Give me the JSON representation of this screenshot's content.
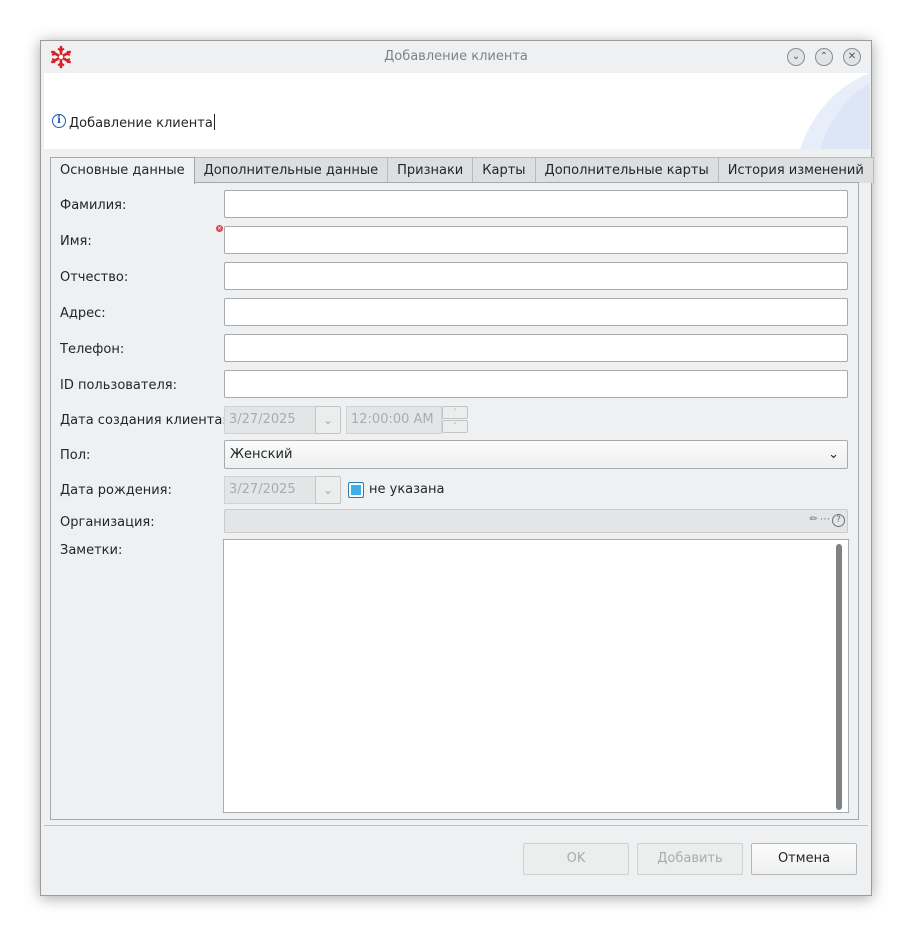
{
  "window": {
    "title": "Добавление клиента",
    "header_message": "Добавление клиента"
  },
  "tabs": [
    {
      "label": "Основные данные",
      "active": true
    },
    {
      "label": "Дополнительные данные"
    },
    {
      "label": "Признаки"
    },
    {
      "label": "Карты"
    },
    {
      "label": "Дополнительные карты"
    },
    {
      "label": "История изменений"
    }
  ],
  "form": {
    "last_name_label": "Фамилия:",
    "first_name_label": "Имя:",
    "middle_name_label": "Отчество:",
    "address_label": "Адрес:",
    "phone_label": "Телефон:",
    "user_id_label": "ID пользователя:",
    "created_label": "Дата создания клиента:",
    "created_date": "3/27/2025",
    "created_time": "12:00:00 AM",
    "gender_label": "Пол:",
    "gender_value": "Женский",
    "birth_label": "Дата рождения:",
    "birth_date": "3/27/2025",
    "birth_unspecified_label": "не указана",
    "org_label": "Организация:",
    "notes_label": "Заметки:"
  },
  "buttons": {
    "ok": "OK",
    "add": "Добавить",
    "cancel": "Отмена"
  },
  "colors": {
    "accent": "#3daee9",
    "app_icon": "#da1f26",
    "required": "#da4453"
  }
}
